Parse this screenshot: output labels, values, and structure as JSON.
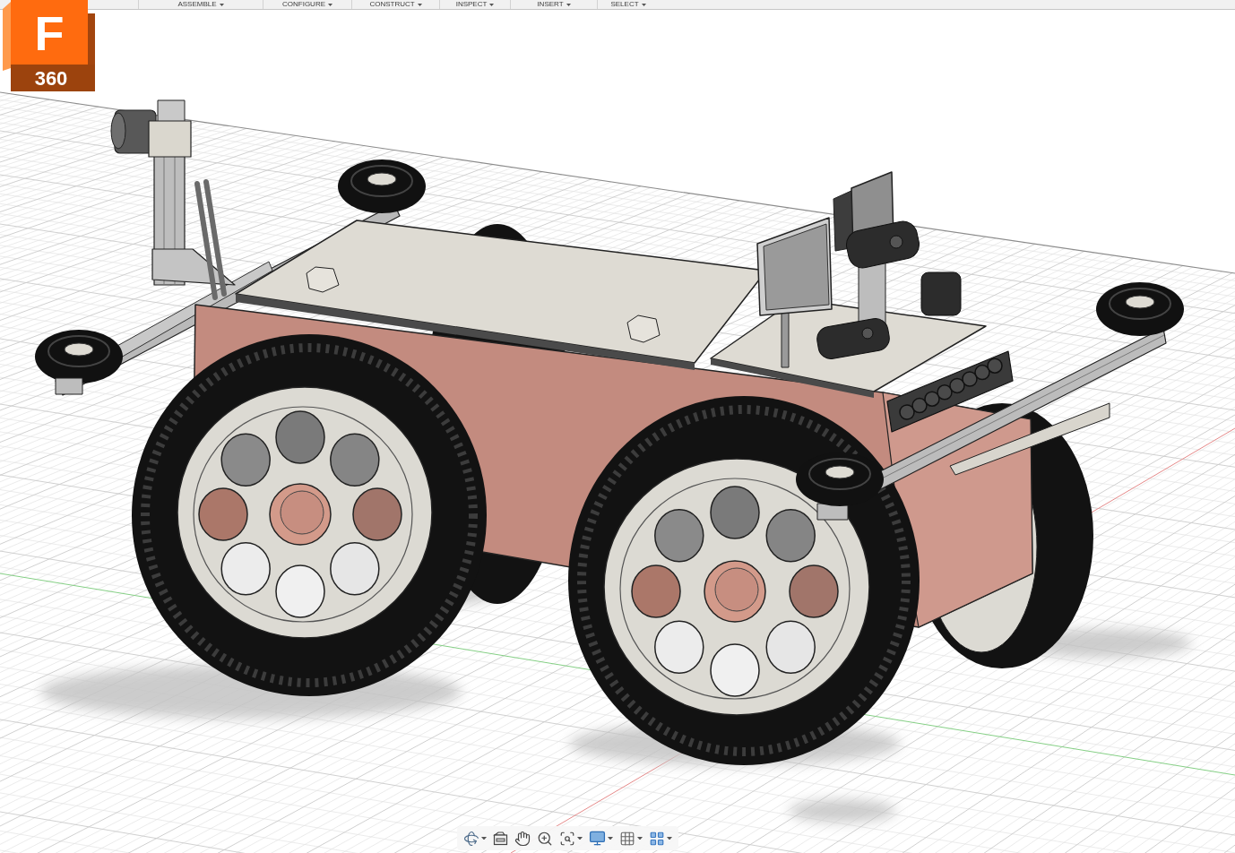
{
  "logo": {
    "letter": "F",
    "version": "360"
  },
  "toolbar": {
    "menus": [
      {
        "label": "ASSEMBLE",
        "dropdown": true
      },
      {
        "label": "CONFIGURE",
        "dropdown": true
      },
      {
        "label": "CONSTRUCT",
        "dropdown": true
      },
      {
        "label": "INSPECT",
        "dropdown": true
      },
      {
        "label": "INSERT",
        "dropdown": true
      },
      {
        "label": "SELECT",
        "dropdown": true
      }
    ]
  },
  "navigation_bar": {
    "tools": [
      {
        "kind": "orbit",
        "dropdown": true
      },
      {
        "kind": "look_at",
        "dropdown": false
      },
      {
        "kind": "pan",
        "dropdown": false
      },
      {
        "kind": "zoom",
        "dropdown": false
      },
      {
        "kind": "fit",
        "dropdown": true
      },
      {
        "kind": "display",
        "dropdown": true
      },
      {
        "kind": "grid",
        "dropdown": true
      },
      {
        "kind": "viewports",
        "dropdown": true
      }
    ]
  }
}
